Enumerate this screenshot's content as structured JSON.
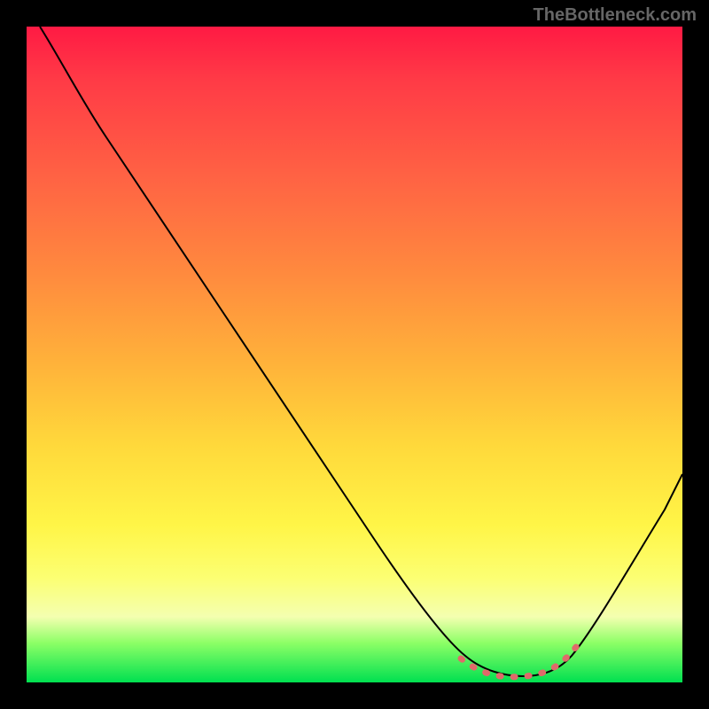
{
  "watermark": "TheBottleneck.com",
  "chart_data": {
    "type": "line",
    "title": "",
    "xlabel": "",
    "ylabel": "",
    "x_range": [
      0,
      100
    ],
    "y_range": [
      0,
      100
    ],
    "curve_points": [
      {
        "x": 2,
        "y": 100
      },
      {
        "x": 6,
        "y": 93
      },
      {
        "x": 12,
        "y": 85
      },
      {
        "x": 20,
        "y": 73
      },
      {
        "x": 30,
        "y": 58
      },
      {
        "x": 40,
        "y": 43
      },
      {
        "x": 50,
        "y": 28
      },
      {
        "x": 60,
        "y": 13
      },
      {
        "x": 66,
        "y": 5
      },
      {
        "x": 70,
        "y": 2
      },
      {
        "x": 75,
        "y": 1
      },
      {
        "x": 80,
        "y": 2
      },
      {
        "x": 85,
        "y": 6
      },
      {
        "x": 90,
        "y": 14
      },
      {
        "x": 95,
        "y": 24
      },
      {
        "x": 100,
        "y": 34
      }
    ],
    "optimal_range_x": [
      67,
      83
    ],
    "gradient_stops": [
      {
        "pos": 0,
        "color": "#ff1a44"
      },
      {
        "pos": 50,
        "color": "#ffb43a"
      },
      {
        "pos": 80,
        "color": "#fff547"
      },
      {
        "pos": 95,
        "color": "#8cff66"
      },
      {
        "pos": 100,
        "color": "#00e050"
      }
    ]
  }
}
